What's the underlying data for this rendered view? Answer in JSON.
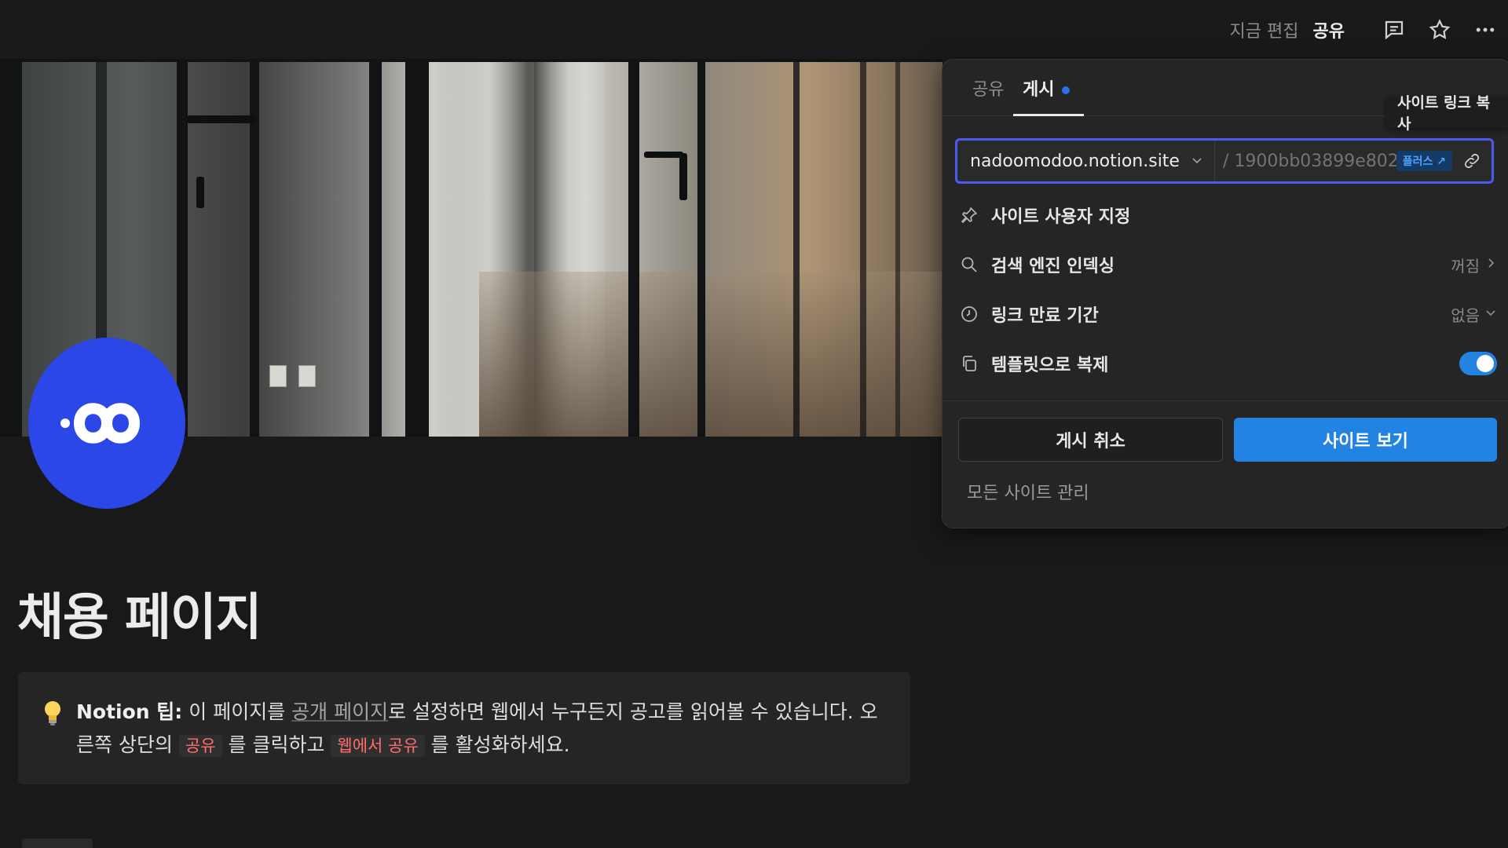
{
  "topbar": {
    "editing_status": "지금 편집",
    "share_label": "공유",
    "icons": [
      "comment-icon",
      "star-icon",
      "more-icon"
    ]
  },
  "page": {
    "title": "채용 페이지",
    "callout": {
      "icon": "lightbulb-icon",
      "bold": "Notion 팁:",
      "text_1": " 이 페이지를 ",
      "link": "공개 페이지",
      "text_2": "로 설정하면 웹에서 누구든지 공고를 읽어볼 수 있습니다. 오른쪽 상단의 ",
      "code_1": "공유",
      "text_3": " 를 클릭하고 ",
      "code_2": "웹에서 공유",
      "text_4": " 를 활성화하세요."
    }
  },
  "publish_panel": {
    "tabs": [
      {
        "label": "공유",
        "active": false
      },
      {
        "label": "게시",
        "active": true
      }
    ],
    "tooltip": "사이트 링크 복사",
    "url": {
      "domain": "nadoomodoo.notion.site",
      "slug": "/ 1900bb03899e802...",
      "badge": "플러스 ↗"
    },
    "rows": [
      {
        "label": "사이트 사용자 지정",
        "icon": "pin-icon",
        "value": ""
      },
      {
        "label": "검색 엔진 인덱싱",
        "icon": "search-icon",
        "value": "꺼짐"
      },
      {
        "label": "링크 만료 기간",
        "icon": "clock-icon",
        "value": "없음"
      },
      {
        "label": "템플릿으로 복제",
        "icon": "duplicate-icon",
        "toggle": true
      }
    ],
    "buttons": {
      "unpublish": "게시 취소",
      "view_site": "사이트 보기"
    },
    "manage_link": "모든 사이트 관리"
  },
  "colors": {
    "background": "#191919",
    "accent_blue": "#2383e2",
    "focus_ring": "#4d5af0",
    "logo_blue": "#2b47e8",
    "code_red": "#ff6e6e"
  }
}
